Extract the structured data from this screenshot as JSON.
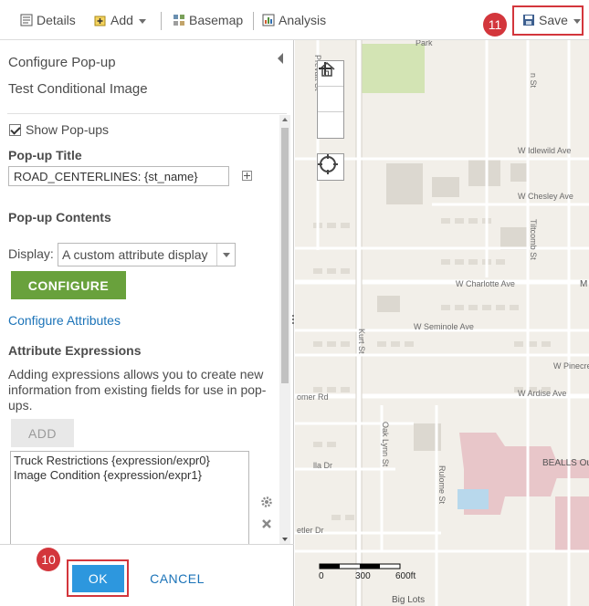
{
  "toolbar": {
    "details": "Details",
    "add": "Add",
    "basemap": "Basemap",
    "analysis": "Analysis",
    "save": "Save",
    "save_step": "11"
  },
  "panel": {
    "title": "Configure Pop-up",
    "layer_name": "Test Conditional Image",
    "show_popups": "Show Pop-ups",
    "popup_title_label": "Pop-up Title",
    "popup_title_value": "ROAD_CENTERLINES: {st_name}",
    "popup_contents_label": "Pop-up Contents",
    "display_label": "Display:",
    "display_value": "A custom attribute display",
    "configure_button": "CONFIGURE",
    "configure_attributes_link": "Configure Attributes",
    "attribute_expressions_label": "Attribute Expressions",
    "attribute_expressions_help": "Adding expressions allows you to create new information from existing fields for use in pop-ups.",
    "add_button": "ADD",
    "expressions": [
      "Truck Restrictions {expression/expr0}",
      "Image Condition {expression/expr1}"
    ],
    "ok_button": "OK",
    "ok_step": "10",
    "cancel_button": "CANCEL"
  },
  "map": {
    "labels": {
      "park": "Park",
      "idlewild": "W Idlewild Ave",
      "chesley": "W Chesley Ave",
      "charlotte": "W Charlotte Ave",
      "seminole": "W Seminole Ave",
      "pinecrest": "W Pinecre",
      "ardise": "W Ardise Ave",
      "omer": "omer Rd",
      "lla": "lla Dr",
      "etler": "etler Dr",
      "bealls": "BEALLS Ou",
      "biglots": "Big Lots",
      "m": "M",
      "prevatt": "Prevatt St",
      "kurt": "Kurt St",
      "oaklynn": "Oak Lynn St",
      "rulome": "Rulome St",
      "tiltcomb": "Tiltcomb St",
      "r_st": "n St"
    },
    "scale": {
      "t0": "0",
      "t1": "300",
      "t2": "600ft"
    }
  }
}
